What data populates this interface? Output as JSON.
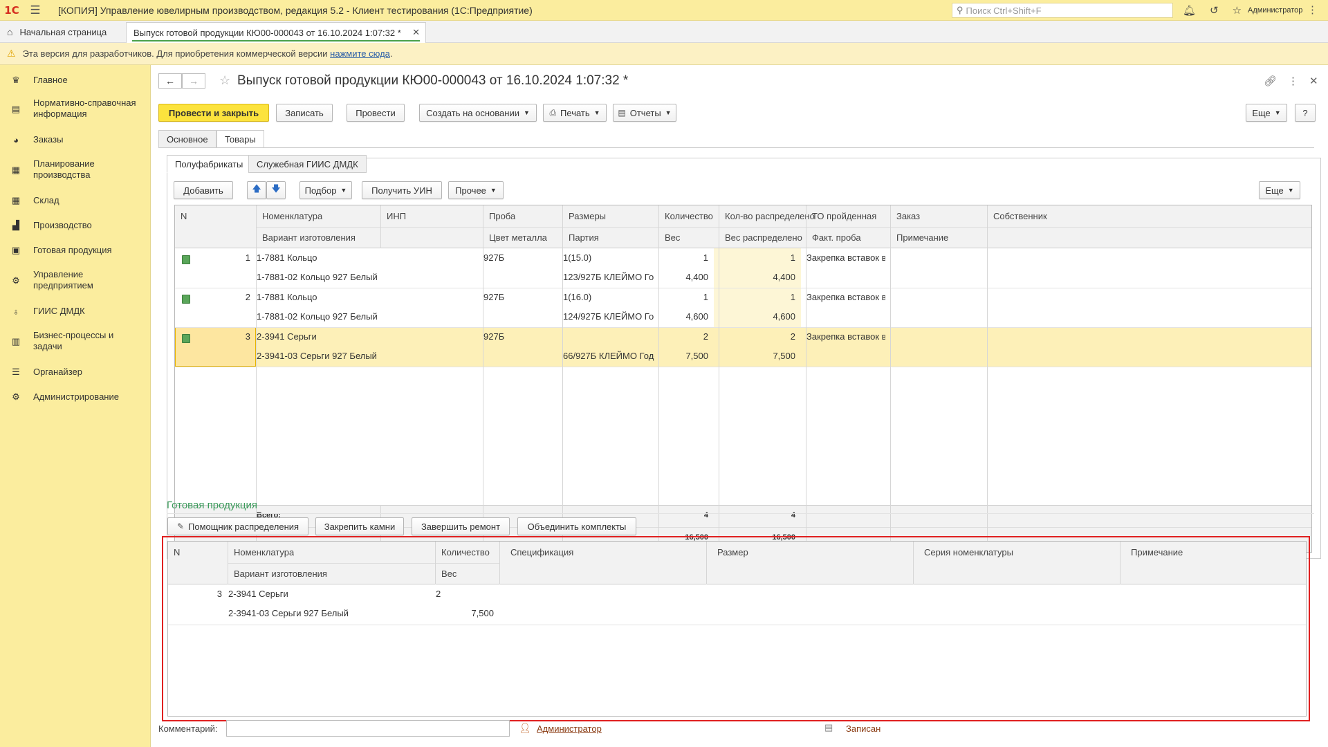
{
  "app": {
    "logo": "1С",
    "title": "[КОПИЯ] Управление ювелирным производством, редакция 5.2  - Клиент тестирования (1С:Предприятие)",
    "search_placeholder": "Поиск Ctrl+Shift+F",
    "user": "Администратор"
  },
  "tabs": {
    "home": "Начальная страница",
    "doc": "Выпуск готовой продукции КЮ00-000043 от 16.10.2024 1:07:32 *"
  },
  "infobar": {
    "text": "Эта версия для разработчиков. Для приобретения коммерческой версии ",
    "link": "нажмите сюда",
    "tail": "."
  },
  "sidebar": {
    "items": [
      {
        "label": "Главное",
        "icon": "crown-icon"
      },
      {
        "label": "Нормативно-справочная информация",
        "icon": "book-icon"
      },
      {
        "label": "Заказы",
        "icon": "pie-icon"
      },
      {
        "label": "Планирование производства",
        "icon": "plan-icon"
      },
      {
        "label": "Склад",
        "icon": "warehouse-icon"
      },
      {
        "label": "Производство",
        "icon": "factory-icon"
      },
      {
        "label": "Готовая продукция",
        "icon": "bag-icon"
      },
      {
        "label": "Управление предприятием",
        "icon": "org-icon"
      },
      {
        "label": "ГИИС ДМДК",
        "icon": "ring-icon"
      },
      {
        "label": "Бизнес-процессы и задачи",
        "icon": "tasks-icon"
      },
      {
        "label": "Органайзер",
        "icon": "organizer-icon"
      },
      {
        "label": "Администрирование",
        "icon": "gear-icon"
      }
    ]
  },
  "document": {
    "title": "Выпуск готовой продукции КЮ00-000043 от 16.10.2024 1:07:32 *"
  },
  "toolbar": {
    "post_close": "Провести и закрыть",
    "save": "Записать",
    "post": "Провести",
    "create_based": "Создать на основании",
    "print": "Печать",
    "reports": "Отчеты",
    "more": "Еще",
    "help": "?"
  },
  "form_tabs": {
    "main": "Основное",
    "goods": "Товары"
  },
  "sub_tabs": {
    "semi": "Полуфабрикаты",
    "giis": "Служебная ГИИС ДМДК"
  },
  "semi_toolbar": {
    "add": "Добавить",
    "select": "Подбор",
    "get_uin": "Получить УИН",
    "other": "Прочее",
    "more": "Еще"
  },
  "semi_table": {
    "headers_top": [
      "N",
      "Номенклатура",
      "ИНП",
      "Проба",
      "Размеры",
      "Количество",
      "Кол-во распределено",
      "ТО пройденная",
      "Заказ",
      "Собственник"
    ],
    "headers_bottom": [
      "Вариант изготовления",
      "Цвет металла",
      "Партия",
      "Вес",
      "Вес распределено",
      "Факт. проба",
      "Примечание"
    ],
    "rows": [
      {
        "n": "1",
        "nom": "1-7881 Кольцо",
        "variant": "1-7881-02 Кольцо 927 Белый",
        "proba": "927Б",
        "size": "1(15.0)",
        "party": "123/927Б КЛЕЙМО Го...",
        "qty": "1",
        "weight": "4,400",
        "qty_dist": "1",
        "weight_dist": "4,400",
        "to": "Закрепка вставок в..."
      },
      {
        "n": "2",
        "nom": "1-7881 Кольцо",
        "variant": "1-7881-02 Кольцо 927 Белый",
        "proba": "927Б",
        "size": "1(16.0)",
        "party": "124/927Б КЛЕЙМО Го...",
        "qty": "1",
        "weight": "4,600",
        "qty_dist": "1",
        "weight_dist": "4,600",
        "to": "Закрепка вставок в..."
      },
      {
        "n": "3",
        "nom": "2-3941 Серьги",
        "variant": "2-3941-03 Серьги 927 Белый",
        "proba": "927Б",
        "size": "",
        "party": "66/927Б КЛЕЙМО Годен",
        "qty": "2",
        "weight": "7,500",
        "qty_dist": "2",
        "weight_dist": "7,500",
        "to": "Закрепка вставок в..."
      }
    ],
    "totals": {
      "label": "Всего:",
      "qty": "4",
      "qty_dist": "4",
      "weight": "16,500",
      "weight_dist": "16,500"
    }
  },
  "finished": {
    "title": "Готовая продукция",
    "buttons": {
      "helper": "Помощник распределения",
      "fix_stones": "Закрепить камни",
      "finish_repair": "Завершить ремонт",
      "merge": "Объединить комплекты"
    },
    "headers_top": [
      "N",
      "Номенклатура",
      "Количество",
      "Спецификация",
      "Размер",
      "Серия номенклатуры",
      "Примечание"
    ],
    "headers_bottom": [
      "Вариант изготовления",
      "Вес"
    ],
    "rows": [
      {
        "n": "3",
        "nom": "2-3941 Серьги",
        "variant": "2-3941-03 Серьги 927 Белый",
        "qty": "2",
        "weight": "7,500"
      }
    ]
  },
  "footer": {
    "comment_label": "Комментарий:",
    "author": "Администратор",
    "status": "Записан"
  }
}
